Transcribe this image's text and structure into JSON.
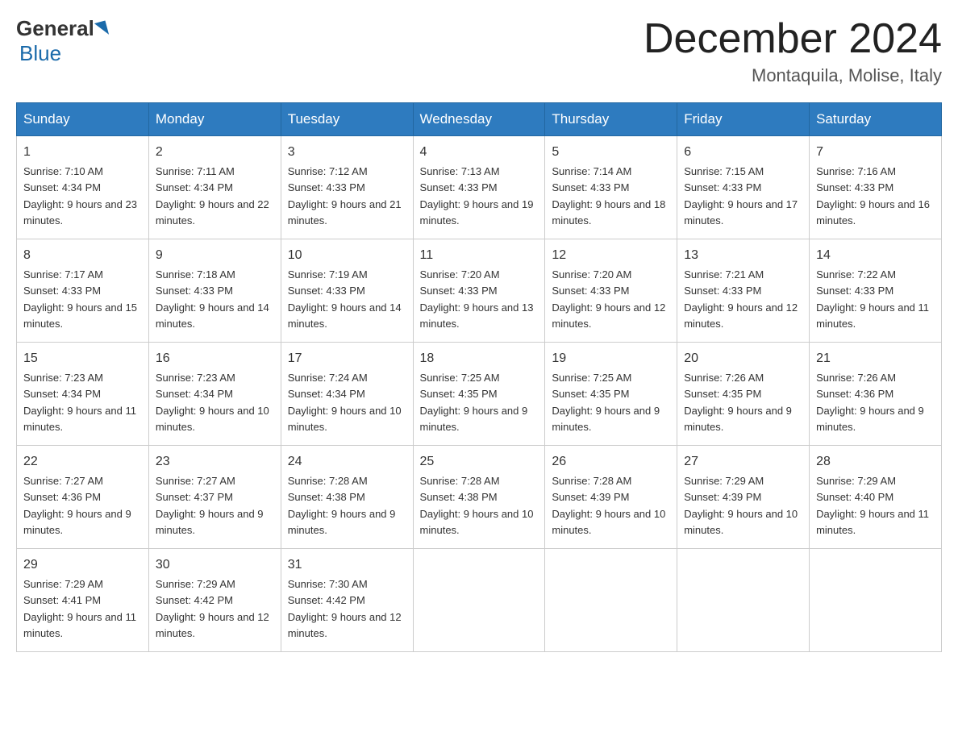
{
  "header": {
    "logo_general": "General",
    "logo_blue": "Blue",
    "month_year": "December 2024",
    "location": "Montaquila, Molise, Italy"
  },
  "weekdays": [
    "Sunday",
    "Monday",
    "Tuesday",
    "Wednesday",
    "Thursday",
    "Friday",
    "Saturday"
  ],
  "weeks": [
    [
      {
        "day": "1",
        "sunrise": "7:10 AM",
        "sunset": "4:34 PM",
        "daylight": "9 hours and 23 minutes."
      },
      {
        "day": "2",
        "sunrise": "7:11 AM",
        "sunset": "4:34 PM",
        "daylight": "9 hours and 22 minutes."
      },
      {
        "day": "3",
        "sunrise": "7:12 AM",
        "sunset": "4:33 PM",
        "daylight": "9 hours and 21 minutes."
      },
      {
        "day": "4",
        "sunrise": "7:13 AM",
        "sunset": "4:33 PM",
        "daylight": "9 hours and 19 minutes."
      },
      {
        "day": "5",
        "sunrise": "7:14 AM",
        "sunset": "4:33 PM",
        "daylight": "9 hours and 18 minutes."
      },
      {
        "day": "6",
        "sunrise": "7:15 AM",
        "sunset": "4:33 PM",
        "daylight": "9 hours and 17 minutes."
      },
      {
        "day": "7",
        "sunrise": "7:16 AM",
        "sunset": "4:33 PM",
        "daylight": "9 hours and 16 minutes."
      }
    ],
    [
      {
        "day": "8",
        "sunrise": "7:17 AM",
        "sunset": "4:33 PM",
        "daylight": "9 hours and 15 minutes."
      },
      {
        "day": "9",
        "sunrise": "7:18 AM",
        "sunset": "4:33 PM",
        "daylight": "9 hours and 14 minutes."
      },
      {
        "day": "10",
        "sunrise": "7:19 AM",
        "sunset": "4:33 PM",
        "daylight": "9 hours and 14 minutes."
      },
      {
        "day": "11",
        "sunrise": "7:20 AM",
        "sunset": "4:33 PM",
        "daylight": "9 hours and 13 minutes."
      },
      {
        "day": "12",
        "sunrise": "7:20 AM",
        "sunset": "4:33 PM",
        "daylight": "9 hours and 12 minutes."
      },
      {
        "day": "13",
        "sunrise": "7:21 AM",
        "sunset": "4:33 PM",
        "daylight": "9 hours and 12 minutes."
      },
      {
        "day": "14",
        "sunrise": "7:22 AM",
        "sunset": "4:33 PM",
        "daylight": "9 hours and 11 minutes."
      }
    ],
    [
      {
        "day": "15",
        "sunrise": "7:23 AM",
        "sunset": "4:34 PM",
        "daylight": "9 hours and 11 minutes."
      },
      {
        "day": "16",
        "sunrise": "7:23 AM",
        "sunset": "4:34 PM",
        "daylight": "9 hours and 10 minutes."
      },
      {
        "day": "17",
        "sunrise": "7:24 AM",
        "sunset": "4:34 PM",
        "daylight": "9 hours and 10 minutes."
      },
      {
        "day": "18",
        "sunrise": "7:25 AM",
        "sunset": "4:35 PM",
        "daylight": "9 hours and 9 minutes."
      },
      {
        "day": "19",
        "sunrise": "7:25 AM",
        "sunset": "4:35 PM",
        "daylight": "9 hours and 9 minutes."
      },
      {
        "day": "20",
        "sunrise": "7:26 AM",
        "sunset": "4:35 PM",
        "daylight": "9 hours and 9 minutes."
      },
      {
        "day": "21",
        "sunrise": "7:26 AM",
        "sunset": "4:36 PM",
        "daylight": "9 hours and 9 minutes."
      }
    ],
    [
      {
        "day": "22",
        "sunrise": "7:27 AM",
        "sunset": "4:36 PM",
        "daylight": "9 hours and 9 minutes."
      },
      {
        "day": "23",
        "sunrise": "7:27 AM",
        "sunset": "4:37 PM",
        "daylight": "9 hours and 9 minutes."
      },
      {
        "day": "24",
        "sunrise": "7:28 AM",
        "sunset": "4:38 PM",
        "daylight": "9 hours and 9 minutes."
      },
      {
        "day": "25",
        "sunrise": "7:28 AM",
        "sunset": "4:38 PM",
        "daylight": "9 hours and 10 minutes."
      },
      {
        "day": "26",
        "sunrise": "7:28 AM",
        "sunset": "4:39 PM",
        "daylight": "9 hours and 10 minutes."
      },
      {
        "day": "27",
        "sunrise": "7:29 AM",
        "sunset": "4:39 PM",
        "daylight": "9 hours and 10 minutes."
      },
      {
        "day": "28",
        "sunrise": "7:29 AM",
        "sunset": "4:40 PM",
        "daylight": "9 hours and 11 minutes."
      }
    ],
    [
      {
        "day": "29",
        "sunrise": "7:29 AM",
        "sunset": "4:41 PM",
        "daylight": "9 hours and 11 minutes."
      },
      {
        "day": "30",
        "sunrise": "7:29 AM",
        "sunset": "4:42 PM",
        "daylight": "9 hours and 12 minutes."
      },
      {
        "day": "31",
        "sunrise": "7:30 AM",
        "sunset": "4:42 PM",
        "daylight": "9 hours and 12 minutes."
      },
      null,
      null,
      null,
      null
    ]
  ]
}
